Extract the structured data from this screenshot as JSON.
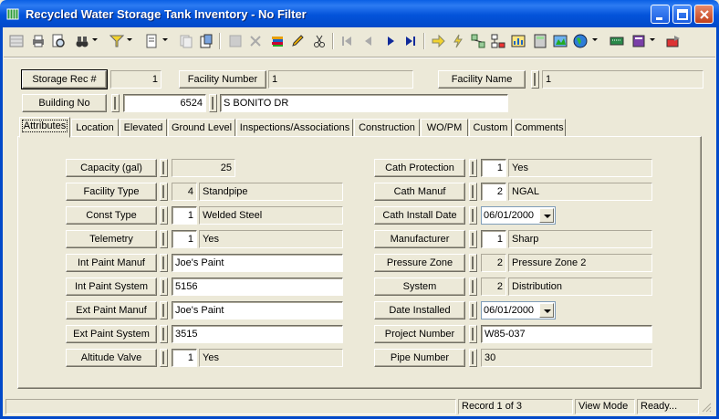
{
  "window": {
    "title": "Recycled Water Storage Tank Inventory - No Filter"
  },
  "header": {
    "storage_rec_label": "Storage Rec #",
    "storage_rec_value": "1",
    "facility_number_label": "Facility Number",
    "facility_number_value": "1",
    "facility_name_label": "Facility Name",
    "facility_name_value": "1",
    "building_no_label": "Building No",
    "building_number": "6524",
    "building_street": "S BONITO DR"
  },
  "tabs": [
    "Attributes",
    "Location",
    "Elevated",
    "Ground Level",
    "Inspections/Associations",
    "Construction",
    "WO/PM",
    "Custom",
    "Comments"
  ],
  "attributes": {
    "capacity_label": "Capacity (gal)",
    "capacity_value": "25",
    "facility_type_label": "Facility Type",
    "facility_type_code": "4",
    "facility_type_value": "Standpipe",
    "const_type_label": "Const Type",
    "const_type_code": "1",
    "const_type_value": "Welded Steel",
    "telemetry_label": "Telemetry",
    "telemetry_code": "1",
    "telemetry_value": "Yes",
    "int_paint_manuf_label": "Int Paint Manuf",
    "int_paint_manuf_value": "Joe's Paint",
    "int_paint_system_label": "Int Paint System",
    "int_paint_system_value": "5156",
    "ext_paint_manuf_label": "Ext Paint Manuf",
    "ext_paint_manuf_value": "Joe's Paint",
    "ext_paint_system_label": "Ext Paint System",
    "ext_paint_system_value": "3515",
    "altitude_valve_label": "Altitude Valve",
    "altitude_valve_code": "1",
    "altitude_valve_value": "Yes",
    "cath_protection_label": "Cath Protection",
    "cath_protection_code": "1",
    "cath_protection_value": "Yes",
    "cath_manuf_label": "Cath Manuf",
    "cath_manuf_code": "2",
    "cath_manuf_value": "NGAL",
    "cath_install_date_label": "Cath Install Date",
    "cath_install_date_value": "06/01/2000",
    "manufacturer_label": "Manufacturer",
    "manufacturer_code": "1",
    "manufacturer_value": "Sharp",
    "pressure_zone_label": "Pressure Zone",
    "pressure_zone_code": "2",
    "pressure_zone_value": "Pressure Zone 2",
    "system_label": "System",
    "system_code": "2",
    "system_value": "Distribution",
    "date_installed_label": "Date Installed",
    "date_installed_value": "06/01/2000",
    "project_number_label": "Project Number",
    "project_number_value": "W85-037",
    "pipe_number_label": "Pipe Number",
    "pipe_number_value": "30"
  },
  "status": {
    "record": "Record 1 of 3",
    "mode": "View Mode",
    "state": "Ready..."
  },
  "colors": {
    "titlebar": "#0353DA",
    "face": "#ECE9D8",
    "close": "#C2401C"
  }
}
